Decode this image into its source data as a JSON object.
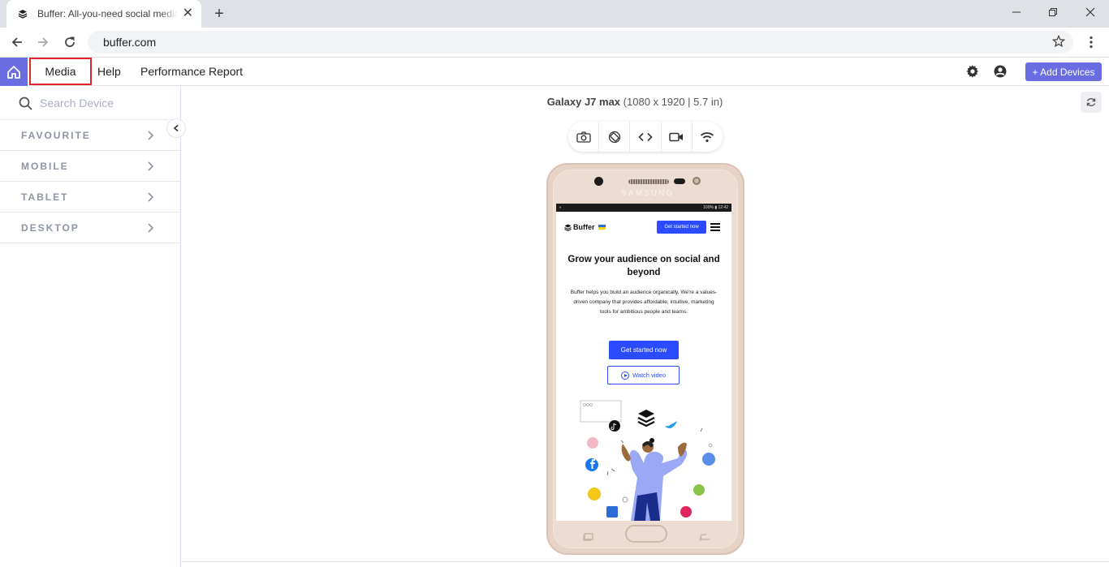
{
  "browser": {
    "tab_title": "Buffer: All-you-need social media",
    "url": "buffer.com"
  },
  "app": {
    "nav": [
      "Media",
      "Help",
      "Performance Report"
    ],
    "add_devices": "+ Add Devices",
    "accent": "#6a6de2"
  },
  "sidebar": {
    "search_placeholder": "Search Device",
    "categories": [
      "FAVOURITE",
      "MOBILE",
      "TABLET",
      "DESKTOP"
    ]
  },
  "device": {
    "name": "Galaxy J7 max",
    "specs": "(1080 x 1920 | 5.7 in)",
    "brand": "SAMSUNG"
  },
  "site": {
    "statusbar_right": "100% ▮ 12:42",
    "logo": "Buffer",
    "cta_top": "Get started now",
    "headline": "Grow your audience on social and beyond",
    "body": "Buffer helps you build an audience organically. We're a values-driven company that provides affordable, intuitive, marketing tools for ambitious people and teams.",
    "cta": "Get started now",
    "watch": "Watch video",
    "brand_color": "#2c4bff"
  }
}
